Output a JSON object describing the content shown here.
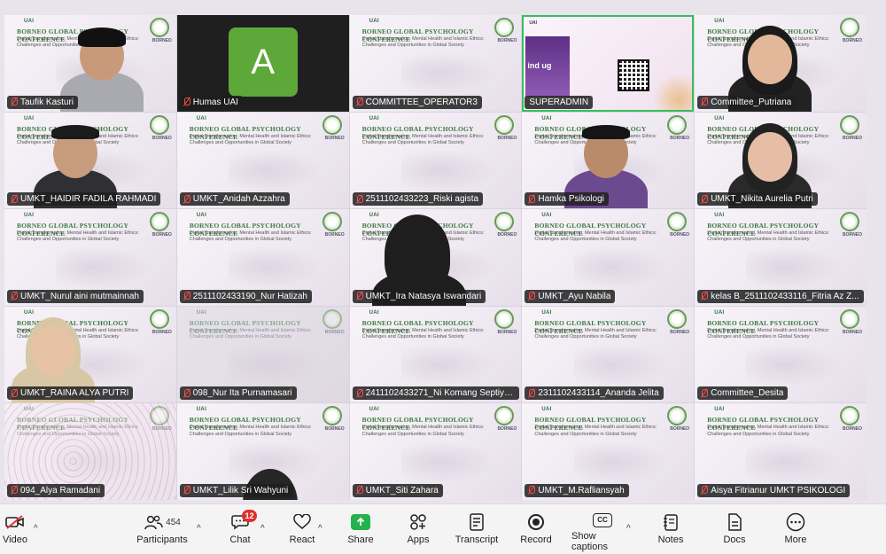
{
  "banner": {
    "logos": "UAI",
    "conference_title": "BORNEO GLOBAL PSYCHOLOGY CONFERENCE",
    "conference_subtitle": "Digital Transformation, Mental Health and Islamic Ethics: Challenges and Opportunities in Global Society",
    "seal_label": "BORNEO"
  },
  "screen_share": {
    "stage_text": "ind ug"
  },
  "participants_grid": [
    {
      "name": "Taufik Kasturi"
    },
    {
      "name": "Humas UAI",
      "avatar_letter": "A"
    },
    {
      "name": "COMMITTEE_OPERATOR3"
    },
    {
      "name": "SUPERADMIN"
    },
    {
      "name": "Committee_Putriana"
    },
    {
      "name": "UMKT_HAIDIR FADILA RAHMADI"
    },
    {
      "name": "UMKT_Anidah Azzahra"
    },
    {
      "name": "2511102433223_Riski agista"
    },
    {
      "name": "Hamka Psikologi"
    },
    {
      "name": "UMKT_Nikita Aurelia Putri"
    },
    {
      "name": "UMKT_Nurul aini mutmainnah"
    },
    {
      "name": "2511102433190_Nur Hatizah"
    },
    {
      "name": "UMKT_Ira Natasya Iswandari"
    },
    {
      "name": "UMKT_Ayu Nabila"
    },
    {
      "name": "kelas B_2511102433116_Fitria Az Z..."
    },
    {
      "name": "UMKT_RAINA ALYA PUTRI"
    },
    {
      "name": "098_Nur Ita Purnamasari"
    },
    {
      "name": "2411102433271_Ni Komang Septiya..."
    },
    {
      "name": "2311102433114_Ananda Jelita"
    },
    {
      "name": "Committee_Desita"
    },
    {
      "name": "094_Alya Ramadani"
    },
    {
      "name": "UMKT_Lilik Sri Wahyuni"
    },
    {
      "name": "UMKT_Siti Zahara"
    },
    {
      "name": "UMKT_M.Rafliansyah"
    },
    {
      "name": "Aisya Fitrianur UMKT PSIKOLOGI"
    }
  ],
  "toolbar": {
    "video": "Video",
    "participants": "Participants",
    "participants_count": "454",
    "chat": "Chat",
    "chat_badge": "12",
    "react": "React",
    "share": "Share",
    "apps": "Apps",
    "transcript": "Transcript",
    "record": "Record",
    "captions": "Show captions",
    "cc": "CC",
    "notes": "Notes",
    "docs": "Docs",
    "more": "More",
    "caret": "^"
  },
  "colors": {
    "active_speaker": "#33c05a",
    "muted_mic": "#ff4d4d",
    "badge": "#e0302f",
    "share_button": "#23b24b",
    "avatar_bg": "#5ea83a"
  }
}
